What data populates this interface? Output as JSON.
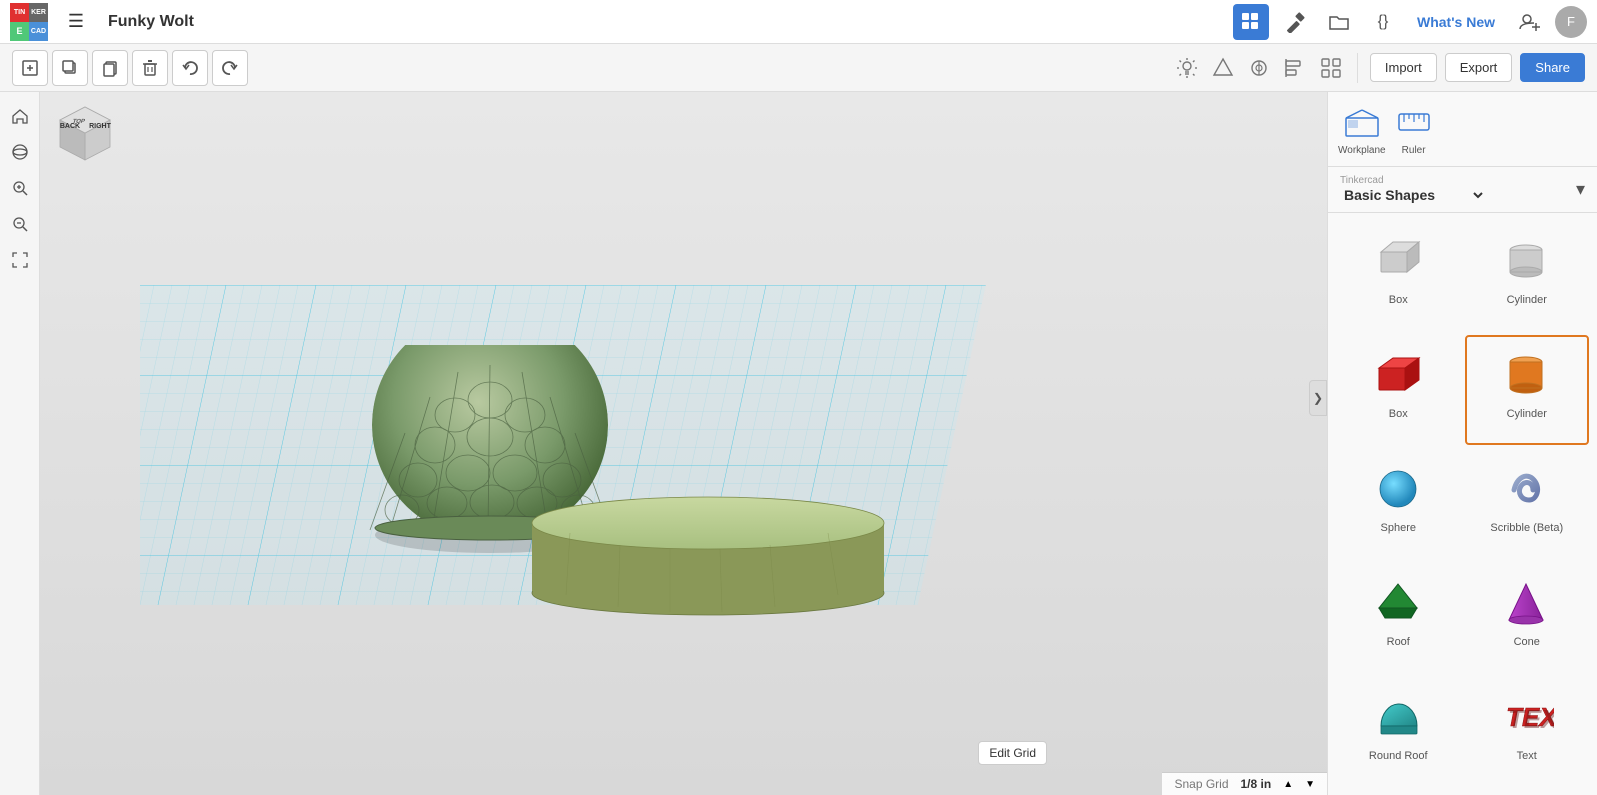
{
  "app": {
    "name": "Tinkercad",
    "project_name": "Funky Wolt"
  },
  "topbar": {
    "logo": {
      "tin": "TIN",
      "ker": "KER",
      "cad": "CAD",
      "blank": "E"
    },
    "icons": [
      {
        "name": "grid-icon",
        "label": "Grid",
        "active": true,
        "symbol": "⊞"
      },
      {
        "name": "hammer-icon",
        "label": "Hammer",
        "active": false,
        "symbol": "⚒"
      },
      {
        "name": "folder-icon",
        "label": "Folder",
        "active": false,
        "symbol": "📁"
      },
      {
        "name": "code-icon",
        "label": "Code",
        "active": false,
        "symbol": "{}"
      }
    ],
    "whats_new": "What's New",
    "account_label": "Account",
    "avatar_initial": "F"
  },
  "toolbar": {
    "tools": [
      {
        "name": "new-design",
        "symbol": "⬜",
        "label": "New"
      },
      {
        "name": "duplicate",
        "symbol": "⧉",
        "label": "Duplicate"
      },
      {
        "name": "copy",
        "symbol": "⧇",
        "label": "Copy"
      },
      {
        "name": "delete",
        "symbol": "🗑",
        "label": "Delete"
      },
      {
        "name": "undo",
        "symbol": "↩",
        "label": "Undo"
      },
      {
        "name": "redo",
        "symbol": "↪",
        "label": "Redo"
      }
    ],
    "right_tools": [
      {
        "name": "light-icon",
        "symbol": "💡"
      },
      {
        "name": "align-icon",
        "symbol": "⬡"
      },
      {
        "name": "mirror-icon",
        "symbol": "⊕"
      },
      {
        "name": "align-left-icon",
        "symbol": "⊟"
      },
      {
        "name": "group-icon",
        "symbol": "⊞"
      }
    ],
    "import_label": "Import",
    "export_label": "Export",
    "share_label": "Share"
  },
  "viewport": {
    "orientation_cube": {
      "top": "TOP",
      "right": "RIGHT",
      "back": "BACK"
    },
    "snap_grid": {
      "label": "Snap Grid",
      "value": "1/8 in"
    },
    "edit_grid_label": "Edit Grid"
  },
  "right_panel": {
    "workplane_label": "Workplane",
    "ruler_label": "Ruler",
    "category_meta": "Tinkercad",
    "category": "Basic Shapes",
    "shapes": [
      {
        "id": "box-gray",
        "label": "Box",
        "color": "#cccccc",
        "type": "box",
        "selected": false,
        "row": 0
      },
      {
        "id": "cylinder-gray",
        "label": "Cylinder",
        "color": "#aaaaaa",
        "type": "cylinder",
        "selected": false,
        "row": 0
      },
      {
        "id": "box-red",
        "label": "Box",
        "color": "#cc2222",
        "type": "box",
        "selected": false,
        "row": 1
      },
      {
        "id": "cylinder-orange",
        "label": "Cylinder",
        "color": "#e07820",
        "type": "cylinder",
        "selected": true,
        "row": 1
      },
      {
        "id": "sphere-blue",
        "label": "Sphere",
        "color": "#33aadd",
        "type": "sphere",
        "selected": false,
        "row": 2
      },
      {
        "id": "scribble-blue",
        "label": "Scribble (Beta)",
        "color": "#7799cc",
        "type": "scribble",
        "selected": false,
        "row": 2
      },
      {
        "id": "roof-green",
        "label": "Roof",
        "color": "#228833",
        "type": "roof",
        "selected": false,
        "row": 3
      },
      {
        "id": "cone-purple",
        "label": "Cone",
        "color": "#9933aa",
        "type": "cone",
        "selected": false,
        "row": 3
      },
      {
        "id": "roundroof-teal",
        "label": "Round Roof",
        "color": "#22aaaa",
        "type": "roundroof",
        "selected": false,
        "row": 4
      },
      {
        "id": "text-red",
        "label": "Text",
        "color": "#cc2222",
        "type": "text",
        "selected": false,
        "row": 4
      }
    ]
  }
}
